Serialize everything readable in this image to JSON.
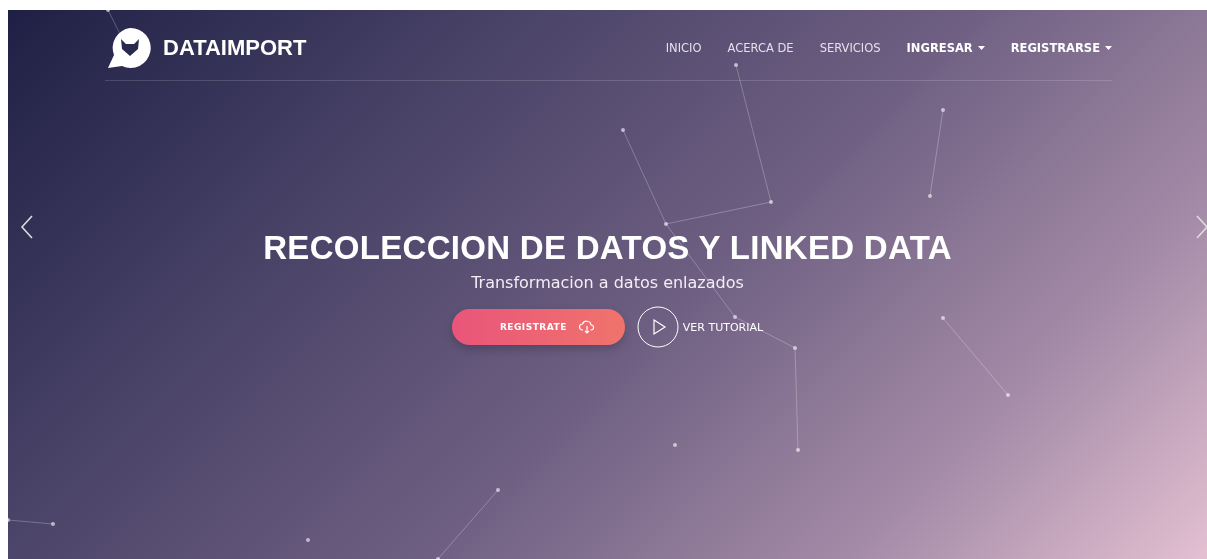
{
  "brand": {
    "name": "DATAIMPORT"
  },
  "nav": [
    {
      "label": "INICIO",
      "kind": "link"
    },
    {
      "label": "ACERCA DE",
      "kind": "link"
    },
    {
      "label": "SERVICIOS",
      "kind": "link"
    },
    {
      "label": "INGRESAR",
      "kind": "dropdown"
    },
    {
      "label": "REGISTRARSE",
      "kind": "dropdown"
    }
  ],
  "hero": {
    "title": "RECOLECCION DE DATOS Y LINKED DATA",
    "subtitle": "Transformacion a datos enlazados",
    "primary_button": "REGISTRATE",
    "secondary_button": "VER TUTORIAL"
  }
}
